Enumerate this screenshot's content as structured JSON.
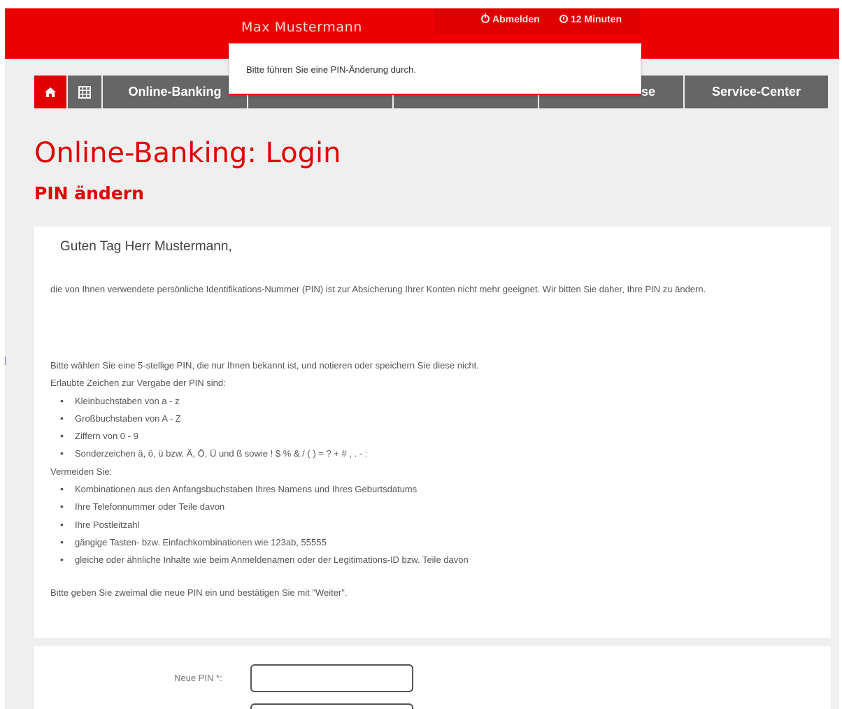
{
  "header": {
    "user_name": "Max Mustermann",
    "logout_label": "Abmelden",
    "timer_label": "12 Minuten"
  },
  "popup": {
    "message": "Bitte führen Sie eine PIN-Änderung durch."
  },
  "nav": {
    "items": [
      {
        "label": "Online-Banking"
      },
      {
        "label": ""
      },
      {
        "label": ""
      },
      {
        "label": "se"
      },
      {
        "label": "Service-Center"
      }
    ]
  },
  "page": {
    "title": "Online-Banking: Login",
    "subtitle": "PIN ändern"
  },
  "content": {
    "greeting": "Guten Tag Herr Mustermann,",
    "intro": "die von Ihnen verwendete persönliche Identifikations-Nummer (PIN) ist zur Absicherung Ihrer Konten nicht mehr geeignet. Wir bitten Sie daher, Ihre PIN zu ändern.",
    "choose_pin": "Bitte wählen Sie eine 5-stellige PIN, die nur Ihnen bekannt ist, und notieren oder speichern Sie diese nicht.",
    "allowed_heading": "Erlaubte Zeichen zur Vergabe der PIN sind:",
    "allowed": [
      "Kleinbuchstaben von a - z",
      "Großbuchstaben von A - Z",
      "Ziffern von 0 - 9",
      "Sonderzeichen ä, ö, ü bzw. Ä, Ö, Ü und ß sowie ! $ % & / ( ) = ? + # , . - :"
    ],
    "avoid_heading": "Vermeiden Sie:",
    "avoid": [
      "Kombinationen aus den Anfangsbuchstaben Ihres Namens und Ihres Geburtsdatums",
      "Ihre Telefonnummer oder Teile davon",
      "Ihre Postleitzahl",
      "gängige Tasten- bzw. Einfachkombinationen wie 123ab, 55555",
      "gleiche oder ähnliche Inhalte wie beim Anmeldenamen oder der Legitimations-ID bzw. Teile davon"
    ],
    "final_note": "Bitte geben Sie zweimal die neue PIN ein und bestätigen Sie mit \"Weiter\"."
  },
  "form": {
    "new_pin_label": "Neue PIN *:",
    "new_pin_value": ""
  },
  "colors": {
    "brand_red": "#ee0000",
    "nav_gray": "#666666"
  }
}
